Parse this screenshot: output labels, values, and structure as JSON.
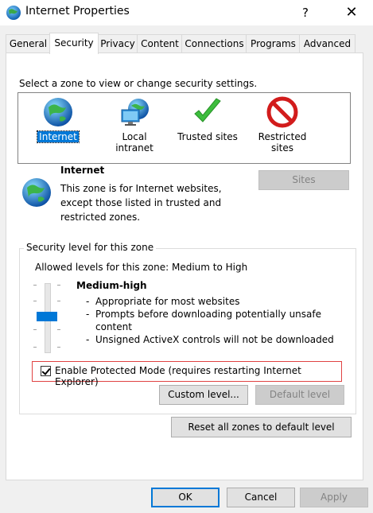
{
  "window": {
    "title": "Internet Properties",
    "help_glyph": "?",
    "close_glyph": "✕"
  },
  "tabs": [
    {
      "label": "General"
    },
    {
      "label": "Security",
      "active": true
    },
    {
      "label": "Privacy"
    },
    {
      "label": "Content"
    },
    {
      "label": "Connections"
    },
    {
      "label": "Programs"
    },
    {
      "label": "Advanced"
    }
  ],
  "security": {
    "zone_caption": "Select a zone to view or change security settings.",
    "zones": [
      {
        "label": "Internet",
        "icon": "globe-icon",
        "selected": true
      },
      {
        "label": "Local intranet",
        "icon": "intranet-icon"
      },
      {
        "label": "Trusted sites",
        "icon": "checkmark-icon"
      },
      {
        "label": "Restricted sites",
        "icon": "restricted-icon"
      }
    ],
    "zone_info": {
      "title": "Internet",
      "description": "This zone is for Internet websites, except those listed in trusted and restricted zones.",
      "sites_label": "Sites"
    },
    "level_group": {
      "caption": "Security level for this zone",
      "allowed_levels": "Allowed levels for this zone: Medium to High",
      "level_name": "Medium-high",
      "bullets": [
        "Appropriate for most websites",
        "Prompts before downloading potentially unsafe content",
        "Unsigned ActiveX controls will not be downloaded"
      ],
      "protected_mode_label": "Enable Protected Mode (requires restarting Internet Explorer)",
      "protected_mode_checked": true,
      "custom_level_label": "Custom level...",
      "default_level_label": "Default level"
    },
    "reset_all_label": "Reset all zones to default level"
  },
  "footer": {
    "ok_label": "OK",
    "cancel_label": "Cancel",
    "apply_label": "Apply"
  },
  "colors": {
    "accent": "#0078d7",
    "highlight_border": "#e04343"
  }
}
